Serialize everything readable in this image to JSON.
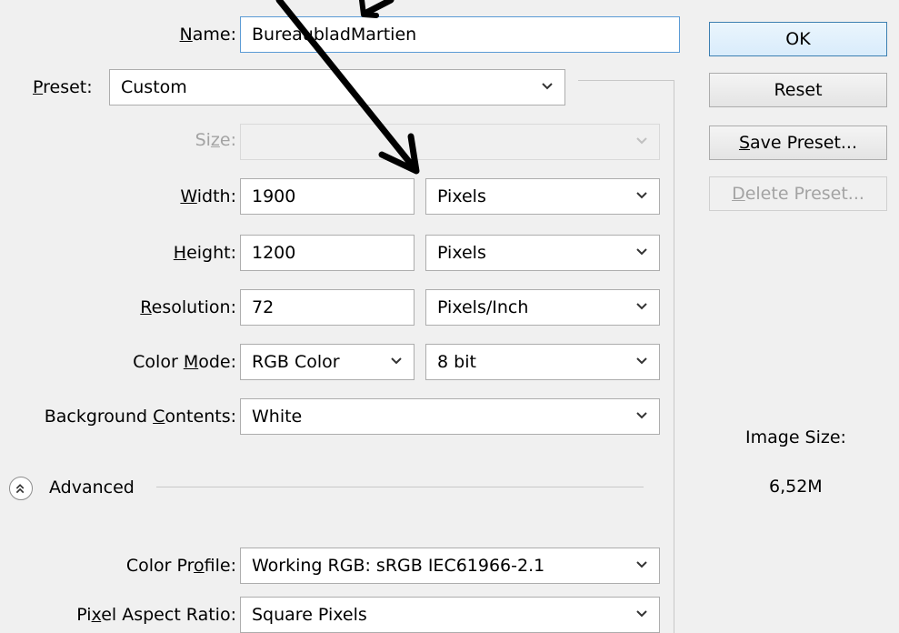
{
  "fields": {
    "name": {
      "label_pre": "",
      "label_u": "N",
      "label_post": "ame:",
      "value": "BureaubladMartien"
    },
    "preset": {
      "label_pre": "",
      "label_u": "P",
      "label_post": "reset:",
      "value": "Custom"
    },
    "size": {
      "label_pre": "Si",
      "label_u": "z",
      "label_post": "e:",
      "value": ""
    },
    "width": {
      "label_pre": "",
      "label_u": "W",
      "label_post": "idth:",
      "value": "1900",
      "unit": "Pixels"
    },
    "height": {
      "label_pre": "",
      "label_u": "H",
      "label_post": "eight:",
      "value": "1200",
      "unit": "Pixels"
    },
    "resolution": {
      "label_pre": "",
      "label_u": "R",
      "label_post": "esolution:",
      "value": "72",
      "unit": "Pixels/Inch"
    },
    "color_mode": {
      "label_pre": "Color ",
      "label_u": "M",
      "label_post": "ode:",
      "value": "RGB Color",
      "depth": "8 bit"
    },
    "background": {
      "label_pre": "Background ",
      "label_u": "C",
      "label_post": "ontents:",
      "value": "White"
    },
    "color_profile": {
      "label_pre": "Color Pr",
      "label_u": "o",
      "label_post": "file:",
      "value": "Working RGB:  sRGB IEC61966-2.1"
    },
    "pixel_aspect": {
      "label_pre": "Pi",
      "label_u": "x",
      "label_post": "el Aspect Ratio:",
      "value": "Square Pixels"
    }
  },
  "advanced": {
    "label": "Advanced"
  },
  "buttons": {
    "ok": "OK",
    "reset": "Reset",
    "save_preset_u": "S",
    "save_preset_rest": "ave Preset...",
    "delete_preset_u": "D",
    "delete_preset_rest": "elete Preset..."
  },
  "image_size": {
    "label": "Image Size:",
    "value": "6,52M"
  },
  "icons": {
    "dropdown": "chevron-down-icon",
    "advanced": "double-chevron-up-icon",
    "annotation": "arrow-annotation"
  }
}
